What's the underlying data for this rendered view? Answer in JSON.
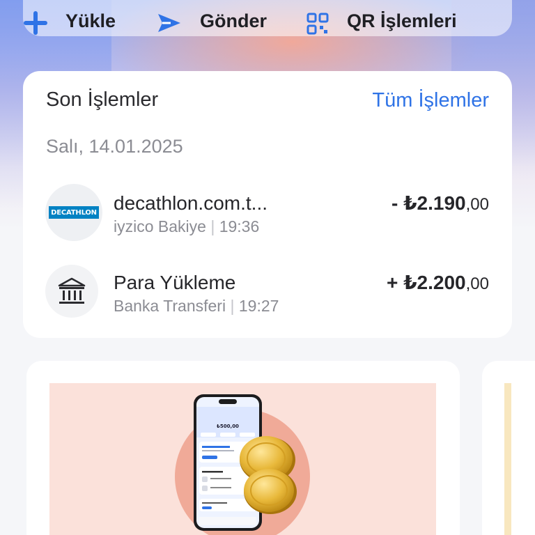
{
  "actions": {
    "load_label": "Yükle",
    "send_label": "Gönder",
    "qr_label": "QR İşlemleri"
  },
  "recent": {
    "title": "Son İşlemler",
    "all_link": "Tüm İşlemler",
    "date": "Salı, 14.01.2025",
    "transactions": [
      {
        "merchant": "decathlon.com.t...",
        "logo_text": "DECATHLON",
        "method": "iyzico Bakiye",
        "time": "19:36",
        "amount_main": "- ₺2.190",
        "amount_decimal": ",00",
        "icon": "decathlon-logo"
      },
      {
        "merchant": "Para Yükleme",
        "method": "Banka Transferi",
        "time": "19:27",
        "amount_main": "+ ₺2.200",
        "amount_decimal": ",00",
        "icon": "bank-icon"
      }
    ]
  },
  "promo": {
    "phone_balance": "₺500,00"
  },
  "colors": {
    "accent": "#2f73e6",
    "decathlon_blue": "#0082c3",
    "promo_bg": "#fbe1da",
    "promo_circle": "#f0aa98"
  }
}
